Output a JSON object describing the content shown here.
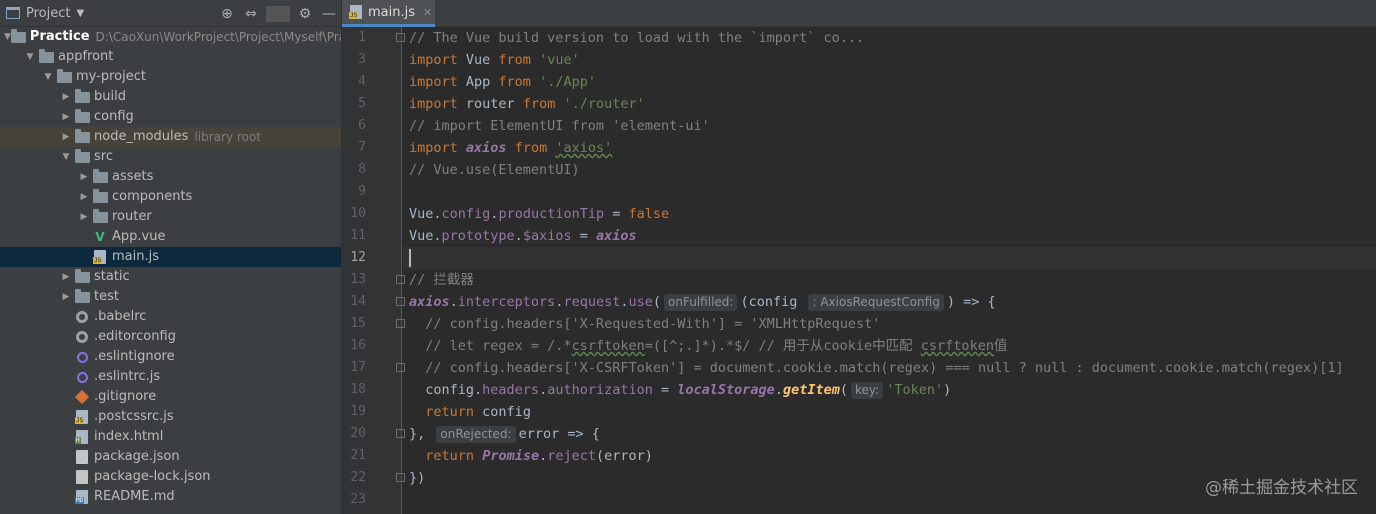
{
  "project_panel": {
    "title": "Project",
    "tree": [
      {
        "label": "Practice",
        "extra": "D:\\CaoXun\\WorkProject\\Project\\Myself\\Pra",
        "depth": 0,
        "arrow": "open",
        "icon": "folder",
        "bold": true
      },
      {
        "label": "appfront",
        "depth": 1,
        "arrow": "open",
        "icon": "folder"
      },
      {
        "label": "my-project",
        "depth": 2,
        "arrow": "open",
        "icon": "folder"
      },
      {
        "label": "build",
        "depth": 3,
        "arrow": "closed",
        "icon": "folder"
      },
      {
        "label": "config",
        "depth": 3,
        "arrow": "closed",
        "icon": "folder"
      },
      {
        "label": "node_modules",
        "extra": "library root",
        "depth": 3,
        "arrow": "closed",
        "icon": "folder",
        "highlight": "library"
      },
      {
        "label": "src",
        "depth": 3,
        "arrow": "open",
        "icon": "folder"
      },
      {
        "label": "assets",
        "depth": 4,
        "arrow": "closed",
        "icon": "folder"
      },
      {
        "label": "components",
        "depth": 4,
        "arrow": "closed",
        "icon": "folder"
      },
      {
        "label": "router",
        "depth": 4,
        "arrow": "closed",
        "icon": "folder"
      },
      {
        "label": "App.vue",
        "depth": 4,
        "arrow": "none",
        "icon": "vue"
      },
      {
        "label": "main.js",
        "depth": 4,
        "arrow": "none",
        "icon": "js",
        "highlight": "selected"
      },
      {
        "label": "static",
        "depth": 3,
        "arrow": "closed",
        "icon": "folder"
      },
      {
        "label": "test",
        "depth": 3,
        "arrow": "closed",
        "icon": "folder"
      },
      {
        "label": ".babelrc",
        "depth": 3,
        "arrow": "none",
        "icon": "config"
      },
      {
        "label": ".editorconfig",
        "depth": 3,
        "arrow": "none",
        "icon": "config"
      },
      {
        "label": ".eslintignore",
        "depth": 3,
        "arrow": "none",
        "icon": "eslint"
      },
      {
        "label": ".eslintrc.js",
        "depth": 3,
        "arrow": "none",
        "icon": "eslint"
      },
      {
        "label": ".gitignore",
        "depth": 3,
        "arrow": "none",
        "icon": "git"
      },
      {
        "label": ".postcssrc.js",
        "depth": 3,
        "arrow": "none",
        "icon": "js"
      },
      {
        "label": "index.html",
        "depth": 3,
        "arrow": "none",
        "icon": "html"
      },
      {
        "label": "package.json",
        "depth": 3,
        "arrow": "none",
        "icon": "json"
      },
      {
        "label": "package-lock.json",
        "depth": 3,
        "arrow": "none",
        "icon": "json"
      },
      {
        "label": "README.md",
        "depth": 3,
        "arrow": "none",
        "icon": "md"
      }
    ]
  },
  "editor": {
    "tab": {
      "label": "main.js",
      "file_tag": "JS"
    },
    "current_line": 12,
    "lines": [
      {
        "n": "1",
        "fold": true,
        "tokens": [
          [
            "cm",
            "// The Vue build version to load with the `import` co..."
          ]
        ]
      },
      {
        "n": "3",
        "tokens": [
          [
            "kw",
            "import"
          ],
          [
            "plain",
            " Vue "
          ],
          [
            "kw",
            "from"
          ],
          [
            "plain",
            " "
          ],
          [
            "str",
            "'vue'"
          ]
        ]
      },
      {
        "n": "4",
        "tokens": [
          [
            "kw",
            "import"
          ],
          [
            "plain",
            " App "
          ],
          [
            "kw",
            "from"
          ],
          [
            "plain",
            " "
          ],
          [
            "str",
            "'./App'"
          ]
        ]
      },
      {
        "n": "5",
        "tokens": [
          [
            "kw",
            "import"
          ],
          [
            "plain",
            " router "
          ],
          [
            "kw",
            "from"
          ],
          [
            "plain",
            " "
          ],
          [
            "str",
            "'./router'"
          ]
        ]
      },
      {
        "n": "6",
        "tokens": [
          [
            "cm",
            "// import ElementUI from 'element-ui'"
          ]
        ]
      },
      {
        "n": "7",
        "tokens": [
          [
            "kw",
            "import"
          ],
          [
            "plain",
            " "
          ],
          [
            "glob",
            "axios"
          ],
          [
            "plain",
            " "
          ],
          [
            "kw",
            "from"
          ],
          [
            "plain",
            " "
          ],
          [
            "str typo",
            "'axios'"
          ]
        ]
      },
      {
        "n": "8",
        "tokens": [
          [
            "cm",
            "// Vue.use(ElementUI)"
          ]
        ]
      },
      {
        "n": "9",
        "tokens": []
      },
      {
        "n": "10",
        "tokens": [
          [
            "plain",
            "Vue."
          ],
          [
            "prop",
            "config"
          ],
          [
            "plain",
            "."
          ],
          [
            "prop",
            "productionTip"
          ],
          [
            "plain",
            " = "
          ],
          [
            "kw",
            "false"
          ]
        ]
      },
      {
        "n": "11",
        "tokens": [
          [
            "plain",
            "Vue."
          ],
          [
            "prop",
            "prototype"
          ],
          [
            "plain",
            "."
          ],
          [
            "prop",
            "$axios"
          ],
          [
            "plain",
            " = "
          ],
          [
            "glob",
            "axios"
          ]
        ]
      },
      {
        "n": "12",
        "tokens": []
      },
      {
        "n": "13",
        "fold": true,
        "tokens": [
          [
            "cm",
            "// 拦截器"
          ]
        ]
      },
      {
        "n": "14",
        "fold": true,
        "tokens": [
          [
            "glob",
            "axios"
          ],
          [
            "plain",
            "."
          ],
          [
            "prop",
            "interceptors"
          ],
          [
            "plain",
            "."
          ],
          [
            "prop",
            "request"
          ],
          [
            "plain",
            "."
          ],
          [
            "prop",
            "use"
          ],
          [
            "plain",
            "("
          ],
          [
            "hint",
            "onFulfilled:"
          ],
          [
            "plain",
            "(config "
          ],
          [
            "hint",
            ": AxiosRequestConfig"
          ],
          [
            "plain",
            ") => {"
          ]
        ]
      },
      {
        "n": "15",
        "fold": true,
        "tokens": [
          [
            "cm",
            "  // config.headers['X-Requested-With'] = 'XMLHttpRequest'"
          ]
        ]
      },
      {
        "n": "16",
        "tokens": [
          [
            "cm",
            "  // let regex = /.*"
          ],
          [
            "cm typo",
            "csrftoken"
          ],
          [
            "cm",
            "=([^;.]*).*$/ // 用于从cookie中匹配 "
          ],
          [
            "cm typo",
            "csrftoken"
          ],
          [
            "cm",
            "值"
          ]
        ]
      },
      {
        "n": "17",
        "fold": true,
        "tokens": [
          [
            "cm",
            "  // config.headers['X-CSRFToken'] = document.cookie.match(regex) === null ? null : document.cookie.match(regex)[1]"
          ]
        ]
      },
      {
        "n": "18",
        "tokens": [
          [
            "plain",
            "  config."
          ],
          [
            "prop",
            "headers"
          ],
          [
            "plain",
            "."
          ],
          [
            "prop",
            "authorization"
          ],
          [
            "plain",
            " = "
          ],
          [
            "glob",
            "localStorage"
          ],
          [
            "plain",
            "."
          ],
          [
            "fnc",
            "getItem"
          ],
          [
            "plain",
            "("
          ],
          [
            "hint",
            "key:"
          ],
          [
            "str",
            "'Token'"
          ],
          [
            "plain",
            ")"
          ]
        ]
      },
      {
        "n": "19",
        "tokens": [
          [
            "plain",
            "  "
          ],
          [
            "kw",
            "return"
          ],
          [
            "plain",
            " config"
          ]
        ]
      },
      {
        "n": "20",
        "fold": true,
        "tokens": [
          [
            "plain",
            "},"
          ],
          [
            "plain",
            " "
          ],
          [
            "hint",
            "onRejected:"
          ],
          [
            "plain",
            "error => {"
          ]
        ]
      },
      {
        "n": "21",
        "tokens": [
          [
            "plain",
            "  "
          ],
          [
            "kw",
            "return"
          ],
          [
            "plain",
            " "
          ],
          [
            "glob",
            "Promise"
          ],
          [
            "plain",
            "."
          ],
          [
            "prop",
            "reject"
          ],
          [
            "plain",
            "(error)"
          ]
        ]
      },
      {
        "n": "22",
        "fold": true,
        "tokens": [
          [
            "plain",
            "})"
          ]
        ]
      },
      {
        "n": "23",
        "tokens": []
      }
    ]
  },
  "watermark": "@稀土掘金技术社区",
  "colors": {
    "accent": "#4a88c7",
    "selection": "#0d293e",
    "background": "#2b2b2b",
    "panel": "#3c3f41"
  }
}
